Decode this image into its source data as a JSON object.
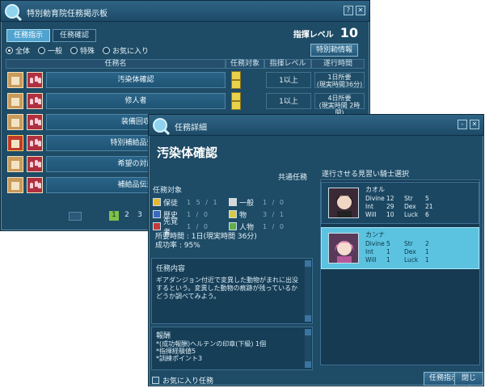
{
  "board": {
    "title": "特別勅育院任務掲示板",
    "tabs": [
      "任務指示",
      "任務確認"
    ],
    "level_label": "指揮レベル",
    "level_value": "10",
    "filters": [
      "全体",
      "一般",
      "特殊",
      "お気に入り"
    ],
    "special_info_button": "特別勅情報",
    "columns": [
      "任務名",
      "任務対象",
      "指揮レベル",
      "遂行時間"
    ],
    "quests": [
      {
        "name": "汚染体確認",
        "level": "1以上",
        "time": "1日所要",
        "time2": "(現実時間36分)"
      },
      {
        "name": "修人者",
        "level": "1以上",
        "time": "4日所要",
        "time2": "(現実時間 2時間)"
      },
      {
        "name": "装備回収",
        "level": "",
        "time": "",
        "time2": ""
      },
      {
        "name": "特別補給品受領",
        "level": "",
        "time": "",
        "time2": ""
      },
      {
        "name": "希望の対応",
        "level": "",
        "time": "",
        "time2": ""
      },
      {
        "name": "補給品伝達",
        "level": "",
        "time": "",
        "time2": ""
      }
    ],
    "pages": [
      "1",
      "2",
      "3"
    ]
  },
  "detail": {
    "title": "任務詳細",
    "quest_name": "汚染体確認",
    "category": "共通任務",
    "target_label": "任務対象",
    "targets": [
      {
        "name": "保徒",
        "nums": "1  5  /  1"
      },
      {
        "name": "一般",
        "nums": "1  /  0"
      },
      {
        "name": "歴史",
        "nums": "1  /  0"
      },
      {
        "name": "物",
        "nums": "3  /  1"
      },
      {
        "name": "先覚者",
        "nums": "1  /  0"
      },
      {
        "name": "人物",
        "nums": "1  /  0"
      }
    ],
    "required_time": "所要時間 : 1日(現実時間 36分)",
    "success_rate": "成功率 : 95%",
    "content_label": "任務内容",
    "content_text": "ギアダンジョン付近で変異した動物がまれに出没するという。変異した動物の痕跡が残っているかどうか調べてみよう。",
    "reward_label": "報酬",
    "rewards": [
      "*(成功報酬)ヘルテンの印章(下級) 1個",
      "*指揮経験値5",
      "*訓練ポイント3"
    ],
    "favorite_label": "お気に入り任務",
    "candidate_label": "遂行させる見習い騎士選択",
    "knights": [
      {
        "name": "カオル",
        "stats": [
          "Divine",
          "12",
          "Str",
          "5",
          "Int",
          "29",
          "Dex",
          "21",
          "Will",
          "10",
          "Luck",
          "6"
        ]
      },
      {
        "name": "カンナ",
        "stats": [
          "Divine",
          "5",
          "Str",
          "2",
          "Int",
          "1",
          "Dex",
          "1",
          "Will",
          "1",
          "Luck",
          "1"
        ]
      }
    ],
    "accept_button": "任務指示",
    "close_button": "閉じる"
  },
  "colors": {
    "window_bg": "#1e4b66",
    "selected": "#5bc3e0",
    "accent": "#4fa3cf"
  }
}
